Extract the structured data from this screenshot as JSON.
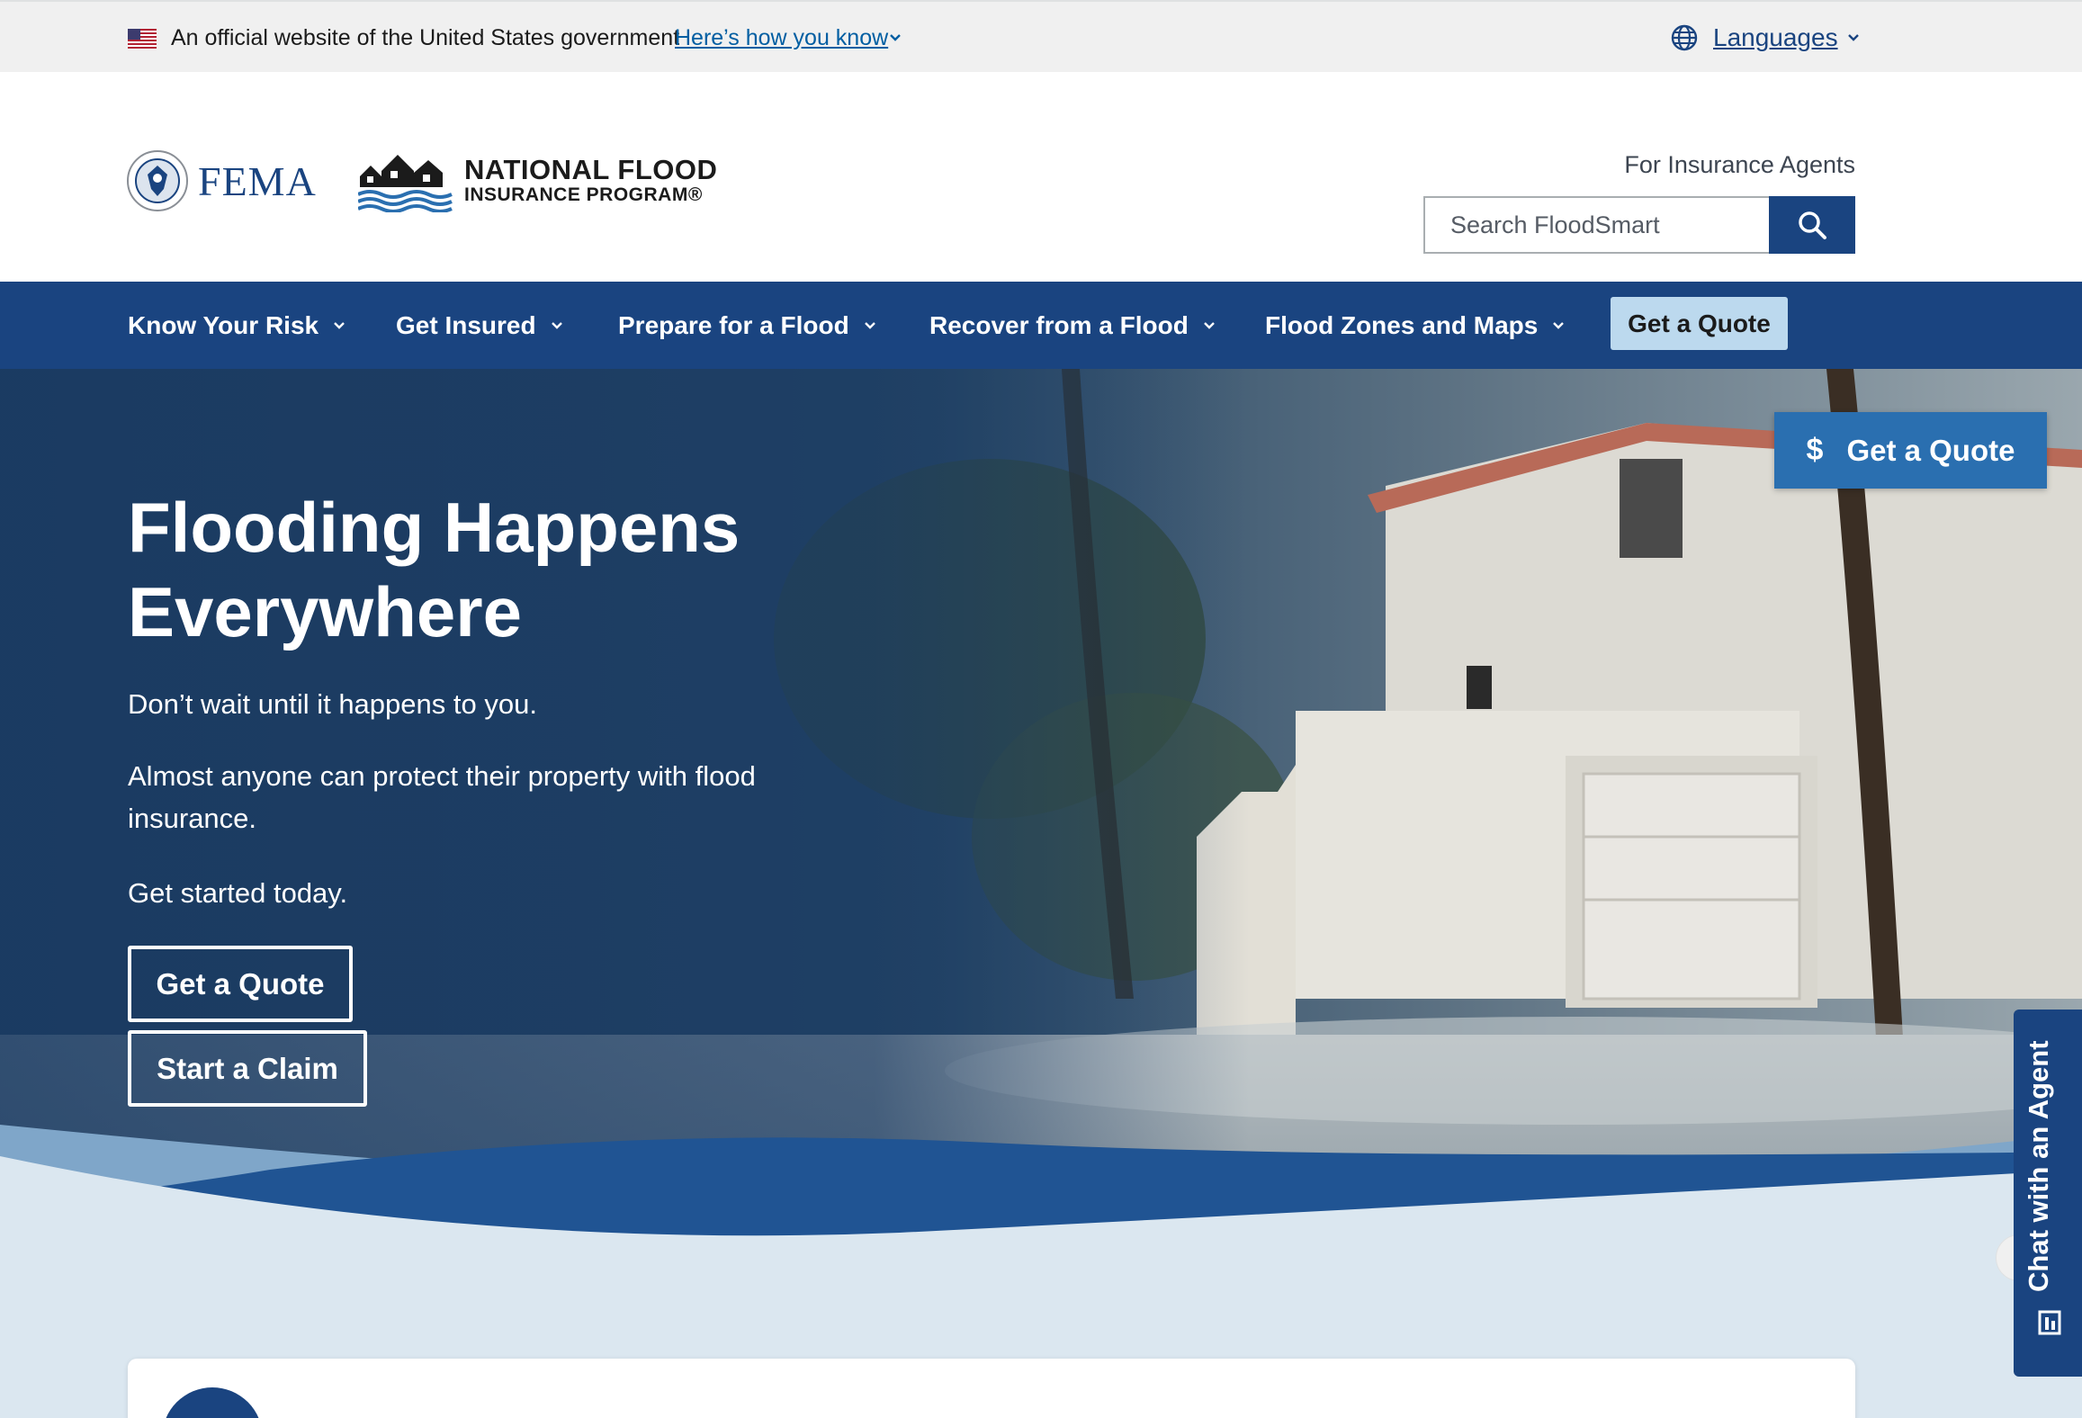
{
  "gov_banner": {
    "text": "An official website of the United States government",
    "link": "Here’s how you know",
    "languages": "Languages"
  },
  "header": {
    "fema": "FEMA",
    "nfip_line1": "NATIONAL FLOOD",
    "nfip_line2": "INSURANCE PROGRAM®",
    "agents_link": "For Insurance Agents",
    "search_placeholder": "Search FloodSmart"
  },
  "nav": {
    "items": [
      {
        "label": "Know Your Risk"
      },
      {
        "label": "Get Insured"
      },
      {
        "label": "Prepare for a Flood"
      },
      {
        "label": "Recover from a Flood"
      },
      {
        "label": "Flood Zones and Maps"
      }
    ],
    "cta": "Get a Quote"
  },
  "hero": {
    "title": "Flooding Happens Everywhere",
    "p1": "Don’t wait until it happens to you.",
    "p2": "Almost anyone can protect their property with flood insurance.",
    "p3": "Get started today.",
    "btn_quote": "Get a Quote",
    "btn_claim": "Start a Claim"
  },
  "floating": {
    "currency_symbol": "$",
    "quote": "Get a Quote",
    "chat": "Chat with an Agent"
  },
  "colors": {
    "navy": "#1a4480",
    "light_blue_button": "#bcd9ee",
    "float_button": "#2a6fb0",
    "link": "#005ea2",
    "wave_light": "#dbe7f0"
  },
  "icons": [
    "us-flag-icon",
    "chevron-down-icon",
    "globe-icon",
    "search-icon",
    "dollar-icon",
    "chat-book-icon"
  ]
}
